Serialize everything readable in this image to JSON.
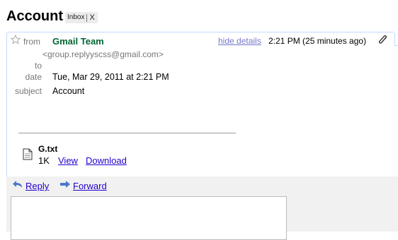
{
  "header": {
    "subject_title": "Account",
    "label": "Inbox",
    "label_remove": "X"
  },
  "message": {
    "from_label": "from",
    "to_label": "to",
    "date_label": "date",
    "subject_label": "subject",
    "sender_name": "Gmail Team",
    "sender_email": "<group.replyyscss@gmail.com>",
    "hide_details": "hide details",
    "time": "2:21 PM (25 minutes ago)",
    "date": "Tue, Mar 29, 2011 at 2:21 PM",
    "subject": "Account"
  },
  "attachment": {
    "name": "G.txt",
    "size": "1K",
    "view": "View",
    "download": "Download"
  },
  "actions": {
    "reply": "Reply",
    "forward": "Forward"
  },
  "colors": {
    "sender": "#006633",
    "link": "#2200cc",
    "hide_details": "#7777cc",
    "reply_bar": "#f1f1f1"
  },
  "icons": [
    "star-icon",
    "paperclip-icon",
    "file-icon",
    "reply-arrow-icon",
    "forward-arrow-icon"
  ]
}
